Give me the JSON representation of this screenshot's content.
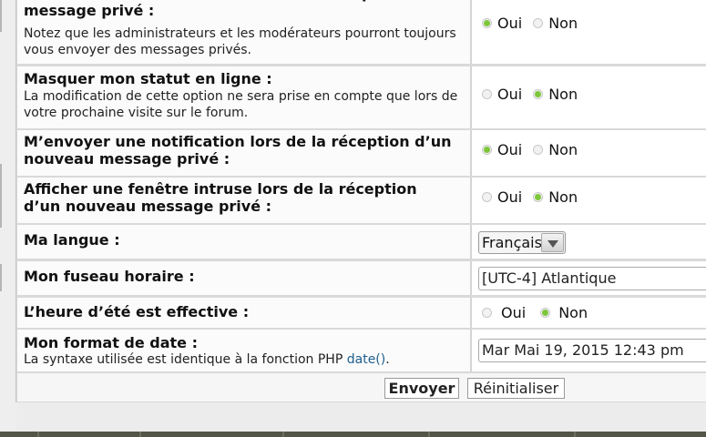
{
  "settings": {
    "rows": [
      {
        "title": "Autoriser les utilisateurs à me contacter par message privé :",
        "description": "Notez que les administrateurs et les modérateurs pourront toujours vous envoyer des messages privés.",
        "oui": "Oui",
        "non": "Non",
        "selected": "Oui"
      },
      {
        "title": "Masquer mon statut en ligne :",
        "description": "La modification de cette option ne sera prise en compte que lors de votre prochaine visite sur le forum.",
        "oui": "Oui",
        "non": "Non",
        "selected": "Non"
      },
      {
        "title": "M’envoyer une notification lors de la réception d’un nouveau message privé :",
        "oui": "Oui",
        "non": "Non",
        "selected": "Oui"
      },
      {
        "title": "Afficher une fenêtre intruse lors de la réception d’un nouveau message privé :",
        "oui": "Oui",
        "non": "Non",
        "selected": "Non"
      },
      {
        "title": "Ma langue :",
        "select_value": "Français"
      },
      {
        "title": "Mon fuseau horaire :",
        "select_value": "[UTC-4] Atlantique"
      },
      {
        "title": "L’heure d’été est effective :",
        "oui": "Oui",
        "non": "Non",
        "selected": "Non"
      },
      {
        "title": "Mon format de date :",
        "description_prefix": "La syntaxe utilisée est identique à la fonction PHP ",
        "description_link": "date()",
        "description_suffix": ".",
        "input_value": "Mar Mai 19, 2015 12:43 pm"
      }
    ]
  },
  "footer": {
    "submit_label": "Envoyer",
    "reset_label": "Réinitialiser"
  },
  "colors": {
    "radio_selected": "#7dc73a",
    "link": "#1d5e8c",
    "bottom_bar": "#535548"
  }
}
